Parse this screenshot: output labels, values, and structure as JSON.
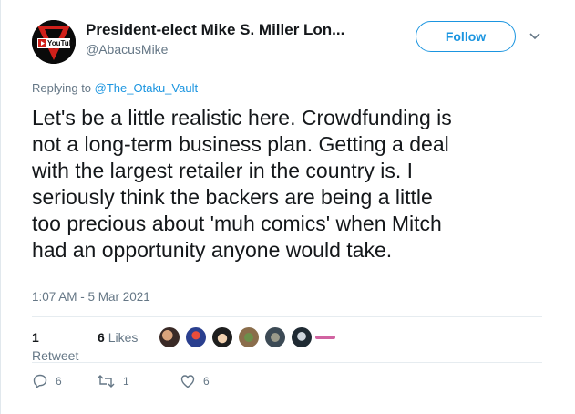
{
  "author": {
    "name": "President-elect Mike S. Miller Lon...",
    "handle": "@AbacusMike",
    "avatar_badge": "YouTube"
  },
  "follow_label": "Follow",
  "reply": {
    "prefix": "Replying to",
    "target": "@The_Otaku_Vault"
  },
  "tweet_lines": [
    "Let's be a little realistic here. Crowdfunding is",
    "not a long-term business plan. Getting a deal",
    "with the largest retailer in the country is. I",
    "seriously think the backers are being a little",
    "too precious about 'muh comics' when Mitch",
    "had an opportunity anyone would take."
  ],
  "timestamp": "1:07 AM - 5 Mar 2021",
  "stats": {
    "retweets_count": "1",
    "retweets_label": "Retweet",
    "likes_count": "6",
    "likes_label": "Likes"
  },
  "actions": {
    "replies": "6",
    "retweets": "1",
    "likes": "6"
  },
  "colors": {
    "accent": "#1b95e0",
    "muted": "#657786",
    "text": "#14171a"
  }
}
